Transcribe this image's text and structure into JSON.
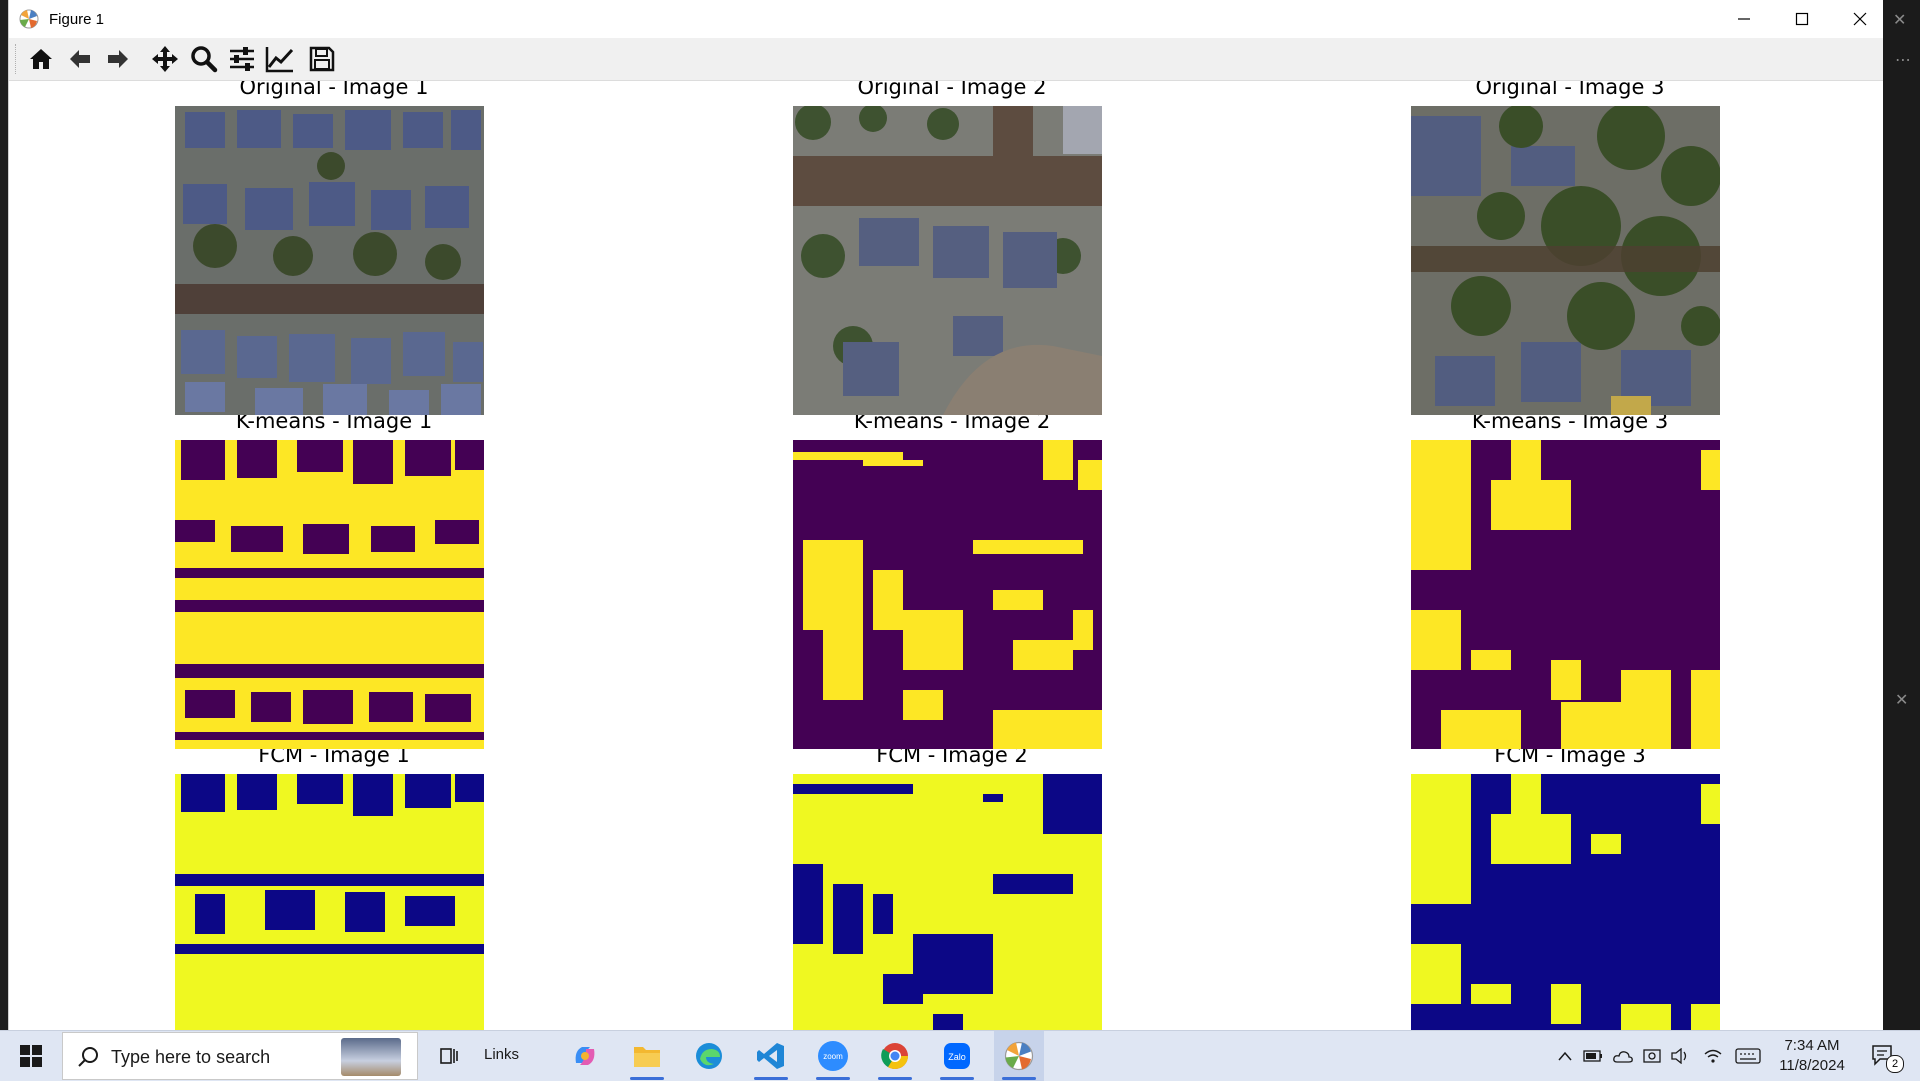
{
  "window": {
    "title": "Figure 1",
    "controls": {
      "minimize": "minimize",
      "maximize": "maximize",
      "close": "close"
    }
  },
  "toolbar": {
    "buttons": [
      {
        "name": "home-icon"
      },
      {
        "name": "back-arrow-icon"
      },
      {
        "name": "forward-arrow-icon"
      },
      {
        "name": "pan-icon"
      },
      {
        "name": "zoom-icon"
      },
      {
        "name": "configure-subplots-icon"
      },
      {
        "name": "edit-axis-icon"
      },
      {
        "name": "save-icon"
      }
    ]
  },
  "figure": {
    "rows": [
      {
        "method": "Original",
        "titles": [
          "Original - Image 1",
          "Original - Image 2",
          "Original - Image 3"
        ]
      },
      {
        "method": "K-means",
        "titles": [
          "K-means - Image 1",
          "K-means - Image 2",
          "K-means - Image 3"
        ]
      },
      {
        "method": "FCM",
        "titles": [
          "FCM - Image 1",
          "FCM - Image 2",
          "FCM - Image 3"
        ]
      }
    ],
    "colors": {
      "kmeans_bg": "#440154",
      "kmeans_fg": "#fde725",
      "fcm_bg": "#0c0786",
      "fcm_fg": "#eff821"
    }
  },
  "taskbar": {
    "search_placeholder": "Type here to search",
    "links_label": "Links",
    "apps": [
      "copilot-icon",
      "file-explorer-icon",
      "edge-icon",
      "vscode-icon",
      "zoom-icon",
      "chrome-icon",
      "zalo-icon",
      "matplotlib-icon"
    ],
    "clock_time": "7:34 AM",
    "clock_date": "11/8/2024",
    "notification_count": "2"
  }
}
